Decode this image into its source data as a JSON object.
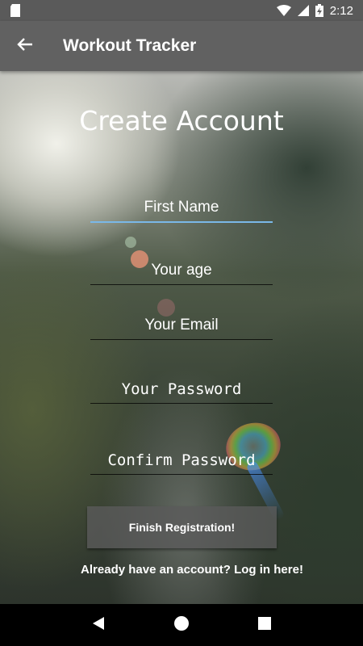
{
  "status_bar": {
    "time": "2:12",
    "icons": [
      "sd-card-icon",
      "wifi-icon",
      "signal-icon",
      "battery-charging-icon"
    ]
  },
  "app_bar": {
    "title": "Workout Tracker",
    "back_icon": "arrow-left-icon"
  },
  "form": {
    "title": "Create Account",
    "fields": {
      "first_name": "First Name",
      "age": "Your age",
      "email": "Your Email",
      "password": "Your Password",
      "confirm_password": "Confirm Password"
    },
    "focused_color": "#7ab8e8",
    "submit_label": "Finish Registration!",
    "login_link": "Already have an account? Log in here!"
  },
  "nav_bar": {
    "icons": [
      "back-triangle-icon",
      "home-circle-icon",
      "recents-square-icon"
    ]
  }
}
